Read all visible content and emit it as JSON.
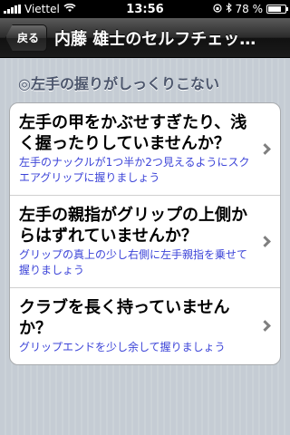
{
  "status_bar": {
    "carrier": "Viettel",
    "time": "13:56",
    "battery_percent": "78 %",
    "battery_level": 0.78
  },
  "nav": {
    "back_label": "戻る",
    "title": "内藤 雄士のセルフチェッ…"
  },
  "section": {
    "header": "◎左手の握りがしっくりこない"
  },
  "items": [
    {
      "title": "左手の甲をかぶせすぎたり、浅く握ったりしていませんか？",
      "subtitle": "左手のナックルが1つ半か2つ見えるようにスクエアグリップに握りましょう"
    },
    {
      "title": "左手の親指がグリップの上側からはずれていませんか？",
      "subtitle": "グリップの真上の少し右側に左手親指を乗せて握りましょう"
    },
    {
      "title": "クラブを長く持っていませんか？",
      "subtitle": "グリップエンドを少し余して握りましょう"
    }
  ]
}
